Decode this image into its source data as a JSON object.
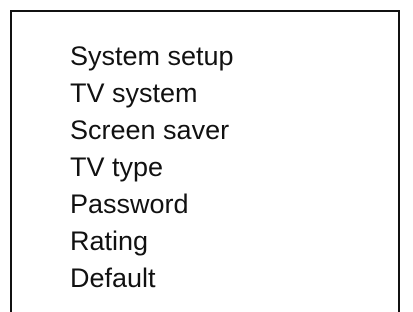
{
  "menu": {
    "items": [
      {
        "label": "System setup"
      },
      {
        "label": "TV system"
      },
      {
        "label": "Screen saver"
      },
      {
        "label": "TV type"
      },
      {
        "label": "Password"
      },
      {
        "label": "Rating"
      },
      {
        "label": "Default"
      }
    ]
  },
  "colors": {
    "text": "#111111",
    "border": "#111111",
    "background": "#ffffff"
  }
}
